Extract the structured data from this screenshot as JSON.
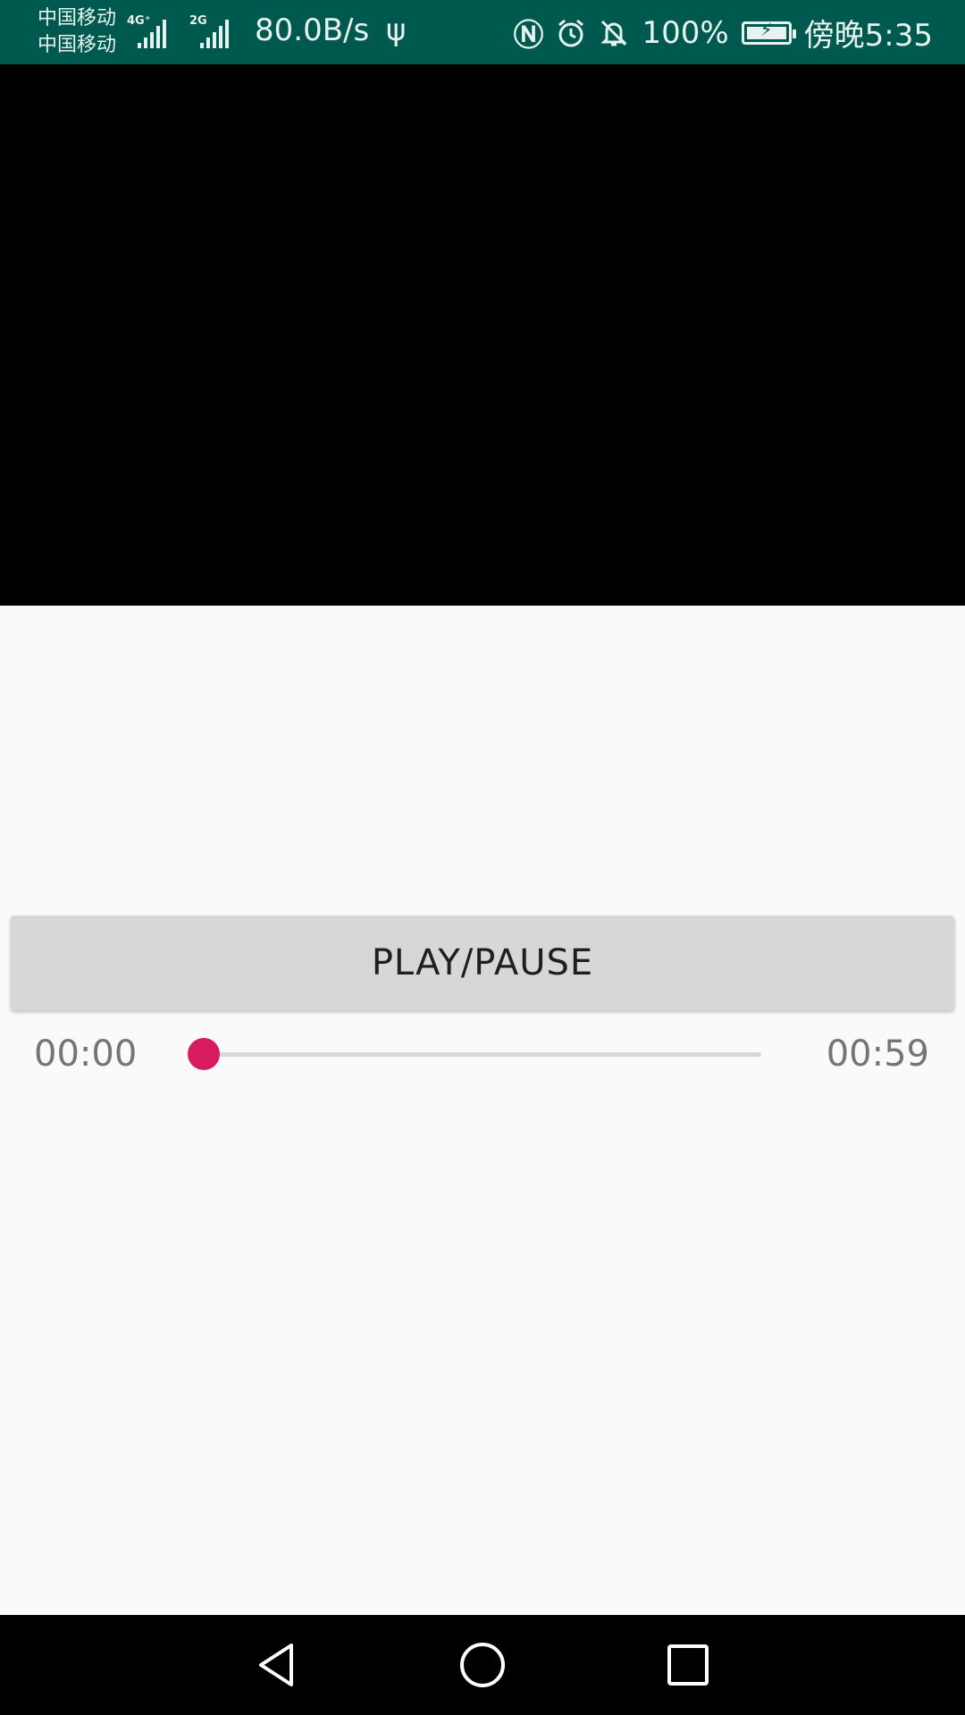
{
  "status_bar": {
    "carrier_1": "中国移动",
    "carrier_2": "中国移动",
    "signal_1_label": "4G⁺",
    "signal_2_label": "2G",
    "net_speed": "80.0B/s",
    "battery": "100%",
    "time": "傍晚5:35",
    "icons": [
      "usb-icon",
      "nfc-icon",
      "alarm-icon",
      "bell-off-icon",
      "battery-charging-icon"
    ]
  },
  "player": {
    "play_pause_label": "PLAY/PAUSE",
    "current_time": "00:00",
    "total_time": "00:59",
    "progress_fraction": 0.0
  },
  "nav_bar": {
    "icons": [
      "back-icon",
      "home-icon",
      "recents-icon"
    ]
  },
  "colors": {
    "status_bar_bg": "#00594f",
    "accent": "#d81b60",
    "button_bg": "#d6d7d7",
    "background": "#fafafa"
  }
}
